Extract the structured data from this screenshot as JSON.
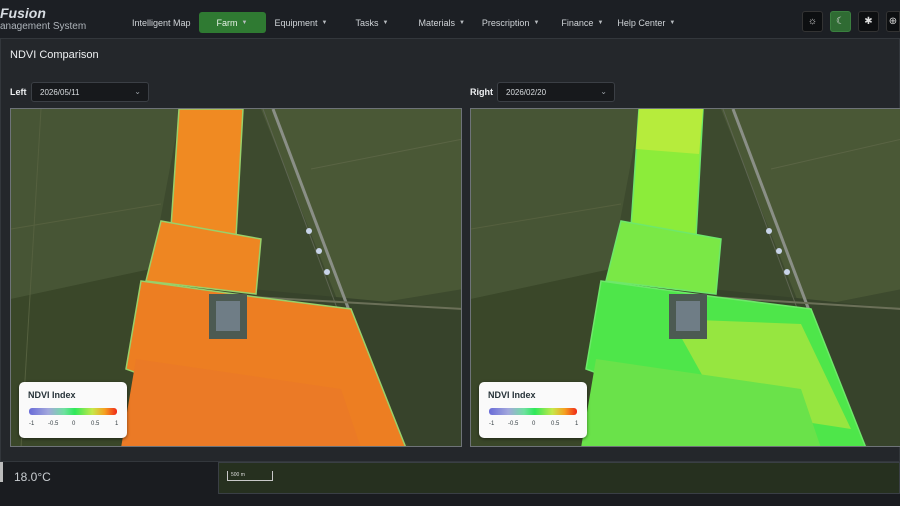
{
  "app": {
    "brand_name": "Fusion",
    "brand_sub": "anagement System"
  },
  "nav": [
    {
      "label": "Intelligent Map",
      "caret": false,
      "active": false
    },
    {
      "label": "Farm",
      "caret": true,
      "active": true
    },
    {
      "label": "Equipment",
      "caret": true,
      "active": false
    },
    {
      "label": "Tasks",
      "caret": true,
      "active": false
    },
    {
      "label": "Materials",
      "caret": true,
      "active": false
    },
    {
      "label": "Prescription",
      "caret": true,
      "active": false
    },
    {
      "label": "Finance",
      "caret": true,
      "active": false
    },
    {
      "label": "Help Center",
      "caret": true,
      "active": false
    }
  ],
  "toolbar_icons": [
    "sun-icon",
    "moon-icon",
    "bug-icon",
    "globe-icon"
  ],
  "modal": {
    "title": "NDVI Comparison",
    "left": {
      "label": "Left",
      "date": "2026/05/11"
    },
    "right": {
      "label": "Right",
      "date": "2026/02/20"
    },
    "legend": {
      "title": "NDVI Index",
      "ticks": [
        "-1",
        "-0.5",
        "0",
        "0.5",
        "1"
      ]
    }
  },
  "background": {
    "temperature": "18.0°C",
    "scale_label": "500 m"
  },
  "colors": {
    "accent_green": "#2f7a32",
    "ndvi_left_fill": "#f08a1e",
    "ndvi_right_fill": "#45e84a"
  }
}
